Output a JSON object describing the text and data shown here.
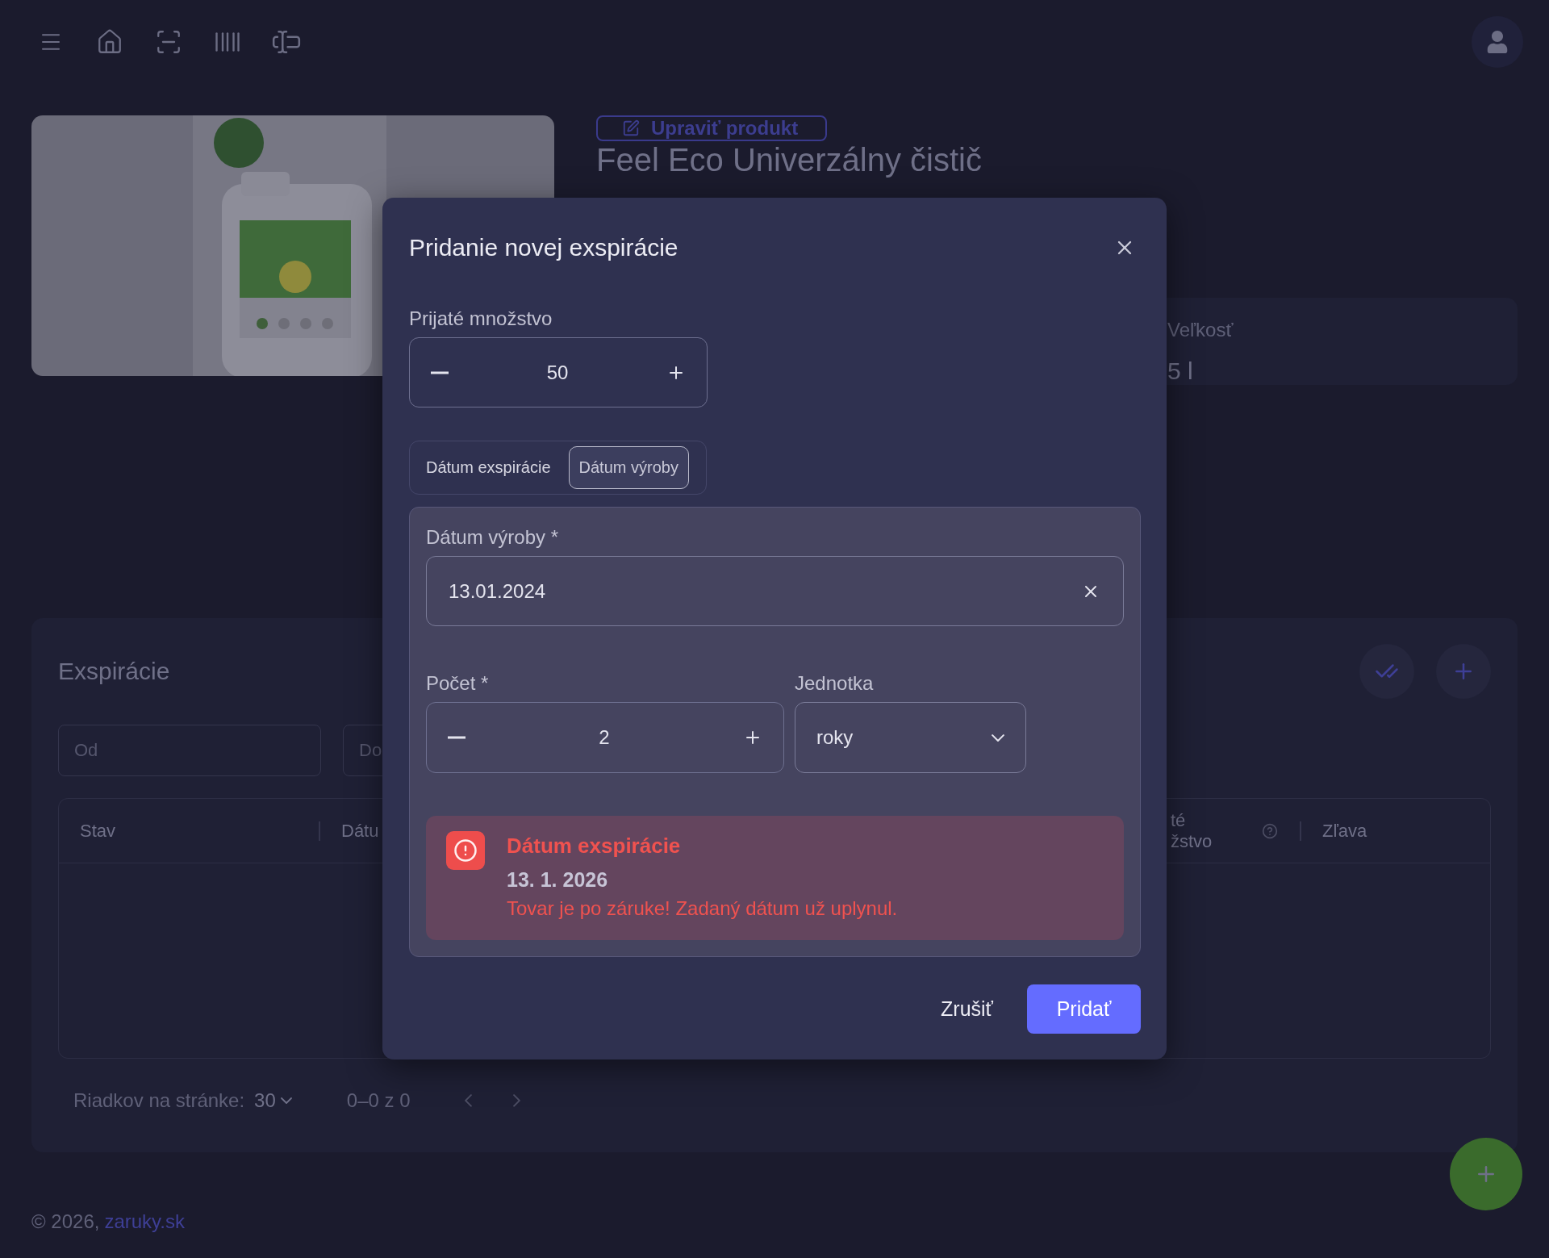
{
  "product": {
    "edit_button": "Upraviť produkt",
    "title": "Feel Eco Univerzálny čistič",
    "attributes": [
      {
        "label": "Veľkosť",
        "value": "5 l"
      }
    ]
  },
  "expirations": {
    "title": "Exspirácie",
    "filters": [
      {
        "placeholder": "Od"
      },
      {
        "placeholder": "Do"
      }
    ],
    "columns": [
      {
        "lines": [
          "Stav"
        ],
        "help": false
      },
      {
        "lines": [
          "Dátu"
        ]
      },
      {
        "lines": [
          "té",
          "žstvo"
        ],
        "help": true
      },
      {
        "lines": [
          "Zľava"
        ],
        "help": false
      }
    ],
    "pagination": {
      "rows_label": "Riadkov na stránke:",
      "rows_value": "30",
      "range": "0–0 z 0"
    }
  },
  "footer": {
    "copyright": "© 2026,",
    "link": "zaruky.sk"
  },
  "dialog": {
    "title": "Pridanie novej exspirácie",
    "quantity": {
      "label": "Prijaté množstvo",
      "value": "50"
    },
    "date_mode": [
      {
        "label": "Dátum exspirácie",
        "selected": false
      },
      {
        "label": "Dátum výroby",
        "selected": true
      }
    ],
    "date_field": {
      "label": "Dátum výroby *",
      "value": "13.01.2024"
    },
    "count": {
      "label": "Počet *",
      "value": "2"
    },
    "unit": {
      "label": "Jednotka",
      "value": "roky"
    },
    "alert": {
      "title": "Dátum exspirácie",
      "date": "13. 1. 2026",
      "message": "Tovar je po záruke! Zadaný dátum už uplynul."
    },
    "buttons": {
      "cancel": "Zrušiť",
      "submit": "Pridať"
    }
  }
}
